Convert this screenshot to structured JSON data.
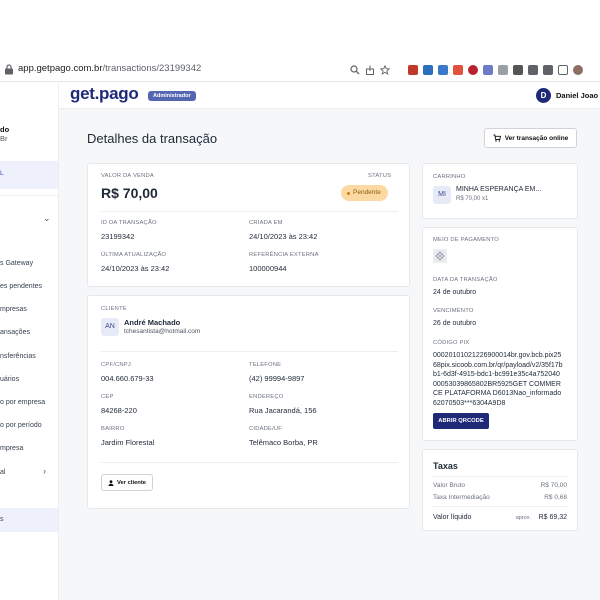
{
  "browser": {
    "url_domain": "app.getpago.com.br",
    "url_path": "/transactions/23199342"
  },
  "sidebar": {
    "user_line1": "do",
    "user_line2": "Br",
    "active_label": "L",
    "items": [
      "s Gateway",
      "es pendentes",
      "mpresas",
      "ansações",
      "nsferências",
      "uários",
      "o por empresa",
      "o por período",
      "mpresa",
      "al"
    ],
    "bottom_label": "s"
  },
  "header": {
    "logo": "get.pago",
    "role_badge": "Administrador",
    "avatar_initial": "D",
    "user_name": "Daniel Joao"
  },
  "page": {
    "title": "Detalhes da transação",
    "view_online_button": "Ver transação online"
  },
  "sale": {
    "value_label": "VALOR DA VENDA",
    "value": "R$ 70,00",
    "status_label": "STATUS",
    "status": "Pendente",
    "id_label": "ID DA TRANSAÇÃO",
    "id": "23199342",
    "created_label": "CRIADA EM",
    "created": "24/10/2023 às 23:42",
    "updated_label": "ÚLTIMA ATUALIZAÇÃO",
    "updated": "24/10/2023 às 23:42",
    "ext_ref_label": "REFERÊNCIA EXTERNA",
    "ext_ref": "100000944"
  },
  "client": {
    "section_label": "CLIENTE",
    "initials": "AN",
    "name": "André Machado",
    "email": "tchesantista@hotmail.com",
    "cpf_label": "CPF/CNPJ",
    "cpf": "004.660.679-33",
    "phone_label": "TELEFONE",
    "phone": "(42) 99994-9897",
    "cep_label": "CEP",
    "cep": "84268-220",
    "address_label": "ENDEREÇO",
    "address": "Rua Jacarandá, 156",
    "district_label": "BAIRRO",
    "district": "Jardim Florestal",
    "city_label": "CIDADE/UF",
    "city": "Telêmaco Borba, PR",
    "view_client_button": "Ver cliente"
  },
  "cart": {
    "label": "CARRINHO",
    "item_initials": "MI",
    "item_name": "MINHA ESPERANÇA EM...",
    "item_price": "R$ 70,00 x1"
  },
  "payment": {
    "method_label": "MEIO DE PAGAMENTO",
    "date_label": "DATA DA TRANSAÇÃO",
    "date": "24 de outubro",
    "due_label": "VENCIMENTO",
    "due": "26 de outubro",
    "pix_label": "CÓDIGO PIX",
    "pix_code": "00020101021226900014br.gov.bcb.pix2568pix.sicoob.com.br/qr/payload/v2/35f17bb1-6d3f-4915-bdc1-bc991e35c4a75204000053039865802BR5925GET COMMERCE PLATAFORMA D6013Nao_informado62070503***6304A9D8",
    "qr_button": "ABRIR QRCODE"
  },
  "fees": {
    "title": "Taxas",
    "gross_label": "Valor Bruto",
    "gross": "R$ 70,00",
    "intermediation_label": "Taxa Intermediação",
    "intermediation": "R$ 0,68",
    "net_label": "Valor líquido",
    "net_prefix": "aprox.",
    "net": "R$ 69,32"
  },
  "colors": {
    "brand": "#1e2a78",
    "status_pending_bg": "#fcd9a3",
    "page_bg": "#f5f7f9"
  }
}
